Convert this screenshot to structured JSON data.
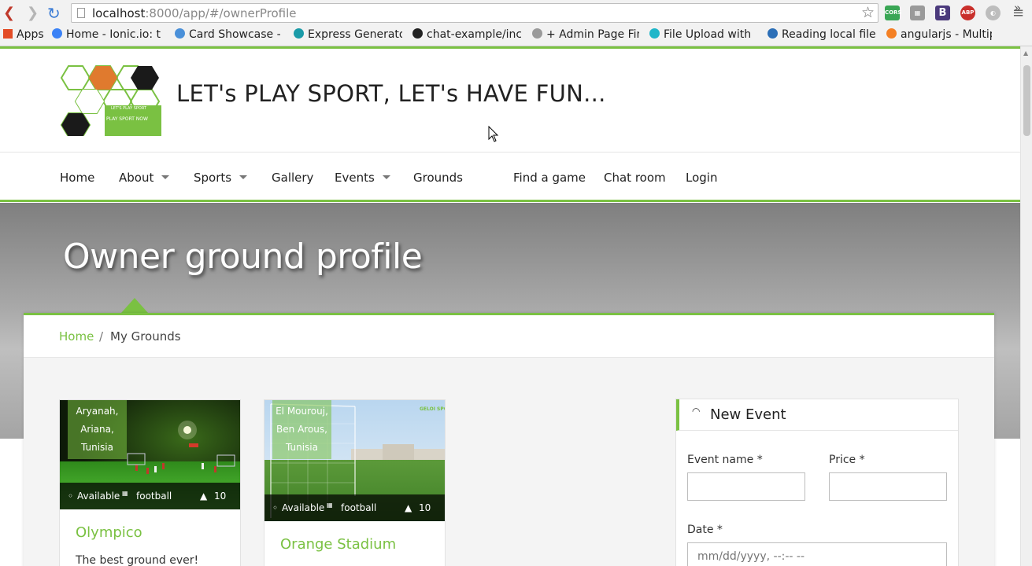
{
  "browser": {
    "url_host": "localhost",
    "url_path": ":8000/app/#/ownerProfile",
    "bookmarks": [
      {
        "label": "Apps",
        "color": "#e34c26"
      },
      {
        "label": "Home - Ionic.io: t",
        "color": "#3b82f6"
      },
      {
        "label": "Card Showcase - I",
        "color": "#4a90d9"
      },
      {
        "label": "Express Generato",
        "color": "#1a9ba8"
      },
      {
        "label": "chat-example/inc",
        "color": "#222222"
      },
      {
        "label": "+ Admin Page Fin",
        "color": "#9a9a9a"
      },
      {
        "label": "File Upload with",
        "color": "#1fb6c9"
      },
      {
        "label": "Reading local file",
        "color": "#2c6fb7"
      },
      {
        "label": "angularjs - Multip",
        "color": "#f48024"
      }
    ],
    "more": "»",
    "extensions": {
      "cors": "CORS",
      "b": "B",
      "abp": "ABP"
    }
  },
  "site": {
    "title": "LET's PLAY SPORT, LET's HAVE FUN...",
    "logo_text_top": "LET'S PLAY SPORT",
    "logo_text_bottom": "PLAY SPORT NOW"
  },
  "nav": [
    {
      "label": "Home",
      "dropdown": false
    },
    {
      "label": "About",
      "dropdown": true
    },
    {
      "label": "Sports",
      "dropdown": true
    },
    {
      "label": "Gallery",
      "dropdown": false
    },
    {
      "label": "Events",
      "dropdown": true
    },
    {
      "label": "Grounds",
      "dropdown": false
    },
    {
      "label": "Find a game",
      "dropdown": false
    },
    {
      "label": "Chat room",
      "dropdown": false
    },
    {
      "label": "Login",
      "dropdown": false
    }
  ],
  "hero": {
    "title": "Owner ground profile"
  },
  "breadcrumb": {
    "home": "Home",
    "separator": "/",
    "current": "My Grounds"
  },
  "grounds": [
    {
      "address_lines": [
        "Aryanah,",
        "Ariana,",
        "Tunisia"
      ],
      "status": "Available",
      "sport": "football",
      "capacity": "10",
      "name": "Olympico",
      "description": "The best ground ever!"
    },
    {
      "address_lines": [
        "El Mourouj,",
        "Ben Arous,",
        "Tunisia"
      ],
      "status": "Available",
      "sport": "football",
      "capacity": "10",
      "name": "Orange Stadium",
      "description": "",
      "watermark": "GELOI SPORT"
    }
  ],
  "new_event": {
    "title": "New Event",
    "event_name_label": "Event name *",
    "price_label": "Price *",
    "date_label": "Date *",
    "date_placeholder": "mm/dd/yyyy, --:-- --"
  },
  "colors": {
    "accent": "#7ac142"
  }
}
